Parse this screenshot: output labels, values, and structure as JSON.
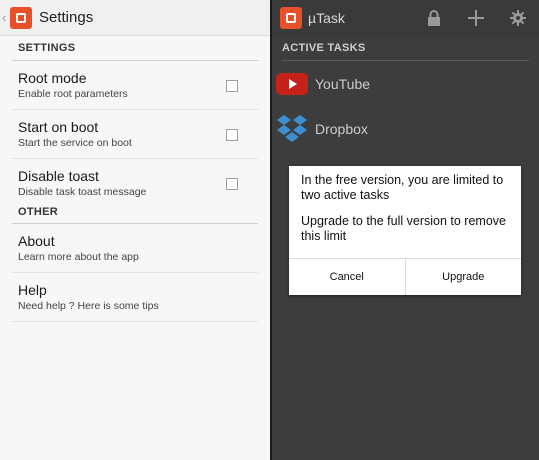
{
  "settings": {
    "title": "Settings",
    "section_settings": "SETTINGS",
    "section_other": "OTHER",
    "items": [
      {
        "title": "Root mode",
        "summary": "Enable root parameters",
        "checked": false
      },
      {
        "title": "Start on boot",
        "summary": "Start the service on boot",
        "checked": false
      },
      {
        "title": "Disable toast",
        "summary": "Disable task toast message",
        "checked": false
      }
    ],
    "other_items": [
      {
        "title": "About",
        "summary": "Learn more about the app"
      },
      {
        "title": "Help",
        "summary": "Need help ? Here is some tips"
      }
    ]
  },
  "main": {
    "title": "µTask",
    "action_icons": [
      "lock-icon",
      "add-icon",
      "gear-icon"
    ],
    "section_active": "ACTIVE TASKS",
    "tasks": [
      {
        "label": "YouTube",
        "icon": "youtube-icon"
      },
      {
        "label": "Dropbox",
        "icon": "dropbox-icon"
      }
    ]
  },
  "dialog": {
    "message_1": "In the free version, you are limited to two active tasks",
    "message_2": "Upgrade to the full version to remove this limit",
    "cancel_label": "Cancel",
    "upgrade_label": "Upgrade"
  },
  "colors": {
    "brand": "#e8502a",
    "youtube": "#c4211a",
    "dropbox": "#3d8fd1"
  }
}
